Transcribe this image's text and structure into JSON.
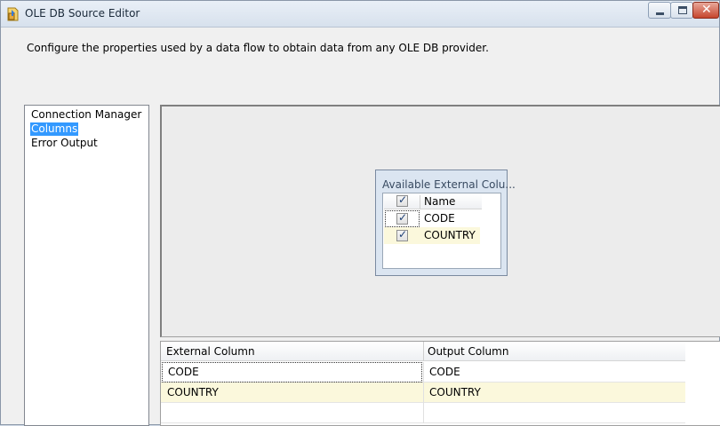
{
  "window": {
    "title": "OLE DB Source Editor",
    "controls": {
      "minimize": "minimize",
      "maximize": "maximize",
      "close": "✕"
    }
  },
  "description": "Configure the properties used by a data flow to obtain data from any OLE DB provider.",
  "nav": {
    "items": [
      {
        "label": "Connection Manager",
        "selected": false
      },
      {
        "label": "Columns",
        "selected": true
      },
      {
        "label": "Error Output",
        "selected": false
      }
    ]
  },
  "available_columns": {
    "title": "Available External Colu...",
    "header": {
      "name": "Name",
      "all_checked": true
    },
    "rows": [
      {
        "name": "CODE",
        "checked": true
      },
      {
        "name": "COUNTRY",
        "checked": true
      }
    ]
  },
  "mapping_grid": {
    "headers": [
      "External Column",
      "Output Column"
    ],
    "rows": [
      {
        "external": "CODE",
        "output": "CODE"
      },
      {
        "external": "COUNTRY",
        "output": "COUNTRY"
      }
    ]
  },
  "colors": {
    "selection": "#3399ff",
    "alt_row": "#fbf8dc",
    "window_bg": "#f0f0f0"
  }
}
